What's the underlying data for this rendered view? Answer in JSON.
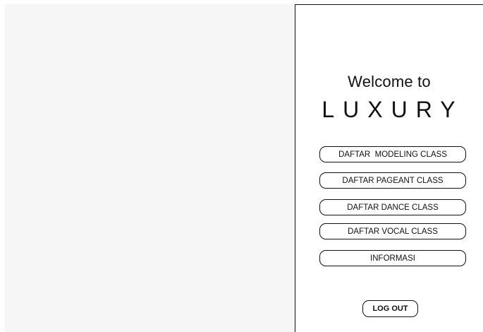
{
  "welcome": {
    "greeting": "Welcome to",
    "brand": "LUXURY"
  },
  "menu": {
    "items": [
      {
        "label": "DAFTAR  MODELING CLASS"
      },
      {
        "label": "DAFTAR PAGEANT CLASS"
      },
      {
        "label": "DAFTAR DANCE CLASS"
      },
      {
        "label": "DAFTAR VOCAL CLASS"
      },
      {
        "label": "INFORMASI"
      }
    ]
  },
  "logout": {
    "label": "LOG OUT"
  },
  "colors": {
    "left_pane_bg": "#f6f6f6",
    "border": "#111111",
    "text": "#111111"
  }
}
